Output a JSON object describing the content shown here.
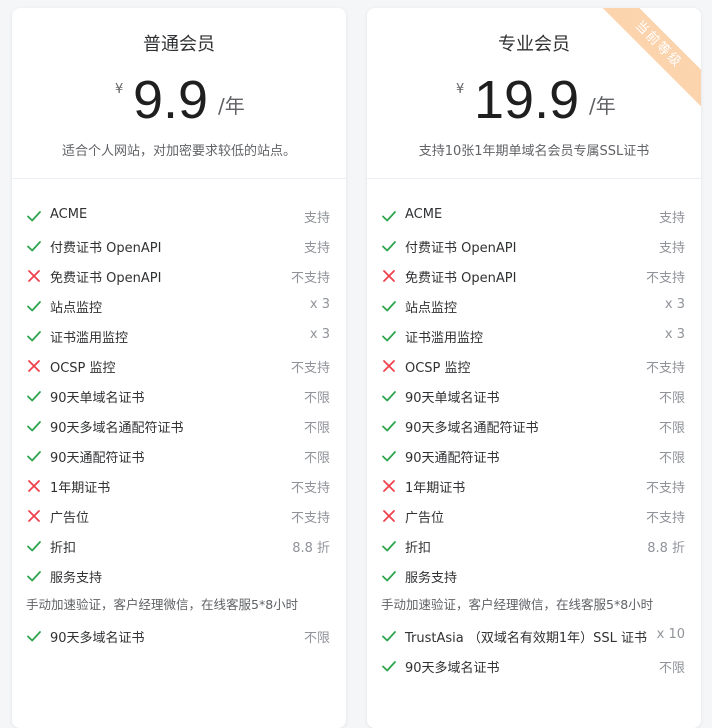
{
  "plans": [
    {
      "name": "普通会员",
      "currency": "¥",
      "price": "9.9",
      "unit": "/年",
      "description": "适合个人网站，对加密要求较低的站点。",
      "features": [
        {
          "label": "ACME",
          "value": "支持",
          "status": "check"
        },
        {
          "label": "付费证书 OpenAPI",
          "value": "支持",
          "status": "check"
        },
        {
          "label": "免费证书 OpenAPI",
          "value": "不支持",
          "status": "cross"
        },
        {
          "label": "站点监控",
          "value": "x 3",
          "status": "check"
        },
        {
          "label": "证书滥用监控",
          "value": "x 3",
          "status": "check"
        },
        {
          "label": "OCSP 监控",
          "value": "不支持",
          "status": "cross"
        },
        {
          "label": "90天单域名证书",
          "value": "不限",
          "status": "check"
        },
        {
          "label": "90天多域名通配符证书",
          "value": "不限",
          "status": "check"
        },
        {
          "label": "90天通配符证书",
          "value": "不限",
          "status": "check"
        },
        {
          "label": "1年期证书",
          "value": "不支持",
          "status": "cross"
        },
        {
          "label": "广告位",
          "value": "不支持",
          "status": "cross"
        },
        {
          "label": "折扣",
          "value": "8.8 折",
          "status": "check"
        },
        {
          "label": "服务支持",
          "value": "",
          "status": "check"
        }
      ],
      "service_note": "手动加速验证，客户经理微信，在线客服5*8小时",
      "extras": [
        {
          "label": "90天多域名证书",
          "value": "不限",
          "status": "check"
        }
      ]
    },
    {
      "name": "专业会员",
      "currency": "¥",
      "price": "19.9",
      "unit": "/年",
      "description": "支持10张1年期单域名会员专属SSL证书",
      "ribbon": "当前等级",
      "features": [
        {
          "label": "ACME",
          "value": "支持",
          "status": "check"
        },
        {
          "label": "付费证书 OpenAPI",
          "value": "支持",
          "status": "check"
        },
        {
          "label": "免费证书 OpenAPI",
          "value": "不支持",
          "status": "cross"
        },
        {
          "label": "站点监控",
          "value": "x 3",
          "status": "check"
        },
        {
          "label": "证书滥用监控",
          "value": "x 3",
          "status": "check"
        },
        {
          "label": "OCSP 监控",
          "value": "不支持",
          "status": "cross"
        },
        {
          "label": "90天单域名证书",
          "value": "不限",
          "status": "check"
        },
        {
          "label": "90天多域名通配符证书",
          "value": "不限",
          "status": "check"
        },
        {
          "label": "90天通配符证书",
          "value": "不限",
          "status": "check"
        },
        {
          "label": "1年期证书",
          "value": "不支持",
          "status": "cross"
        },
        {
          "label": "广告位",
          "value": "不支持",
          "status": "cross"
        },
        {
          "label": "折扣",
          "value": "8.8 折",
          "status": "check"
        },
        {
          "label": "服务支持",
          "value": "",
          "status": "check"
        }
      ],
      "service_note": "手动加速验证，客户经理微信，在线客服5*8小时",
      "extras": [
        {
          "label": "TrustAsia （双域名有效期1年）SSL 证书",
          "value": "x 10",
          "status": "check"
        },
        {
          "label": "90天多域名证书",
          "value": "不限",
          "status": "check"
        }
      ]
    }
  ],
  "colors": {
    "check": "#2ea44f",
    "cross": "#f0424d",
    "ribbon": "#fbd3ad"
  },
  "icons": {
    "check": "check-icon",
    "cross": "cross-icon"
  }
}
